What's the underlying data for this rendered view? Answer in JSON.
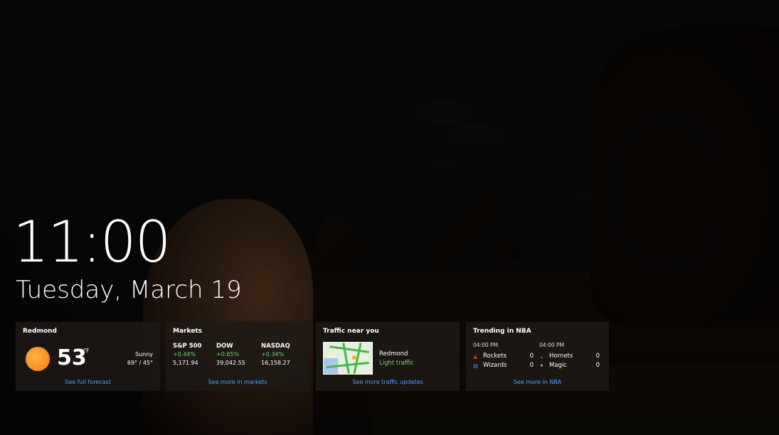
{
  "clock": {
    "time": "11:00",
    "date": "Tuesday, March 19"
  },
  "weather": {
    "title": "Redmond",
    "temperature": "53",
    "unit": "°F",
    "condition": "Sunny",
    "hilo": "69° / 45°",
    "link": "See full forecast",
    "icon": "sun-icon"
  },
  "markets": {
    "title": "Markets",
    "items": [
      {
        "name": "S&P 500",
        "change": "+0.44%",
        "value": "5,171.94"
      },
      {
        "name": "DOW",
        "change": "+0.65%",
        "value": "39,042.55"
      },
      {
        "name": "NASDAQ",
        "change": "+0.34%",
        "value": "16,158.27"
      }
    ],
    "link": "See more in markets"
  },
  "traffic": {
    "title": "Traffic near you",
    "city": "Redmond",
    "status": "Light traffic",
    "link": "See more traffic updates"
  },
  "nba": {
    "title": "Trending in NBA",
    "games": [
      {
        "time": "04:00 PM",
        "teams": [
          {
            "name": "Rockets",
            "score": "0",
            "icon": "rockets-icon"
          },
          {
            "name": "Wizards",
            "score": "0",
            "icon": "wizards-icon"
          }
        ]
      },
      {
        "time": "04:00 PM",
        "teams": [
          {
            "name": "Hornets",
            "score": "0",
            "icon": "hornets-icon"
          },
          {
            "name": "Magic",
            "score": "0",
            "icon": "magic-icon"
          }
        ]
      }
    ],
    "link": "See more in NBA"
  },
  "colors": {
    "link": "#4aa3ff",
    "positive": "#6ed36e",
    "card_bg": "rgba(30,26,22,.82)"
  }
}
